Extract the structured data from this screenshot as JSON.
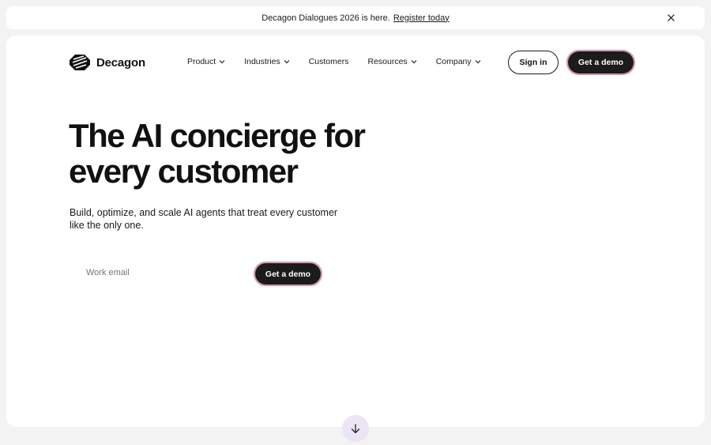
{
  "announcement": {
    "text": "Decagon Dialogues 2026 is here.",
    "link": "Register today"
  },
  "brand": {
    "name": "Decagon"
  },
  "nav": {
    "items": [
      {
        "label": "Product",
        "dropdown": true
      },
      {
        "label": "Industries",
        "dropdown": true
      },
      {
        "label": "Customers",
        "dropdown": false
      },
      {
        "label": "Resources",
        "dropdown": true
      },
      {
        "label": "Company",
        "dropdown": true
      }
    ]
  },
  "header": {
    "signin_label": "Sign in",
    "demo_label": "Get a demo"
  },
  "hero": {
    "headline_line1": "The AI concierge for",
    "headline_line2": "every customer",
    "subtitle_line1": "Build, optimize, and scale AI agents that treat every customer",
    "subtitle_line2": "like the only one.",
    "email_placeholder": "Work email",
    "demo_label": "Get a demo"
  },
  "colors": {
    "button_dark": "#1b1b1b",
    "button_glow_warm": "#e9a58d",
    "button_glow_cool": "#8d7bf0"
  }
}
